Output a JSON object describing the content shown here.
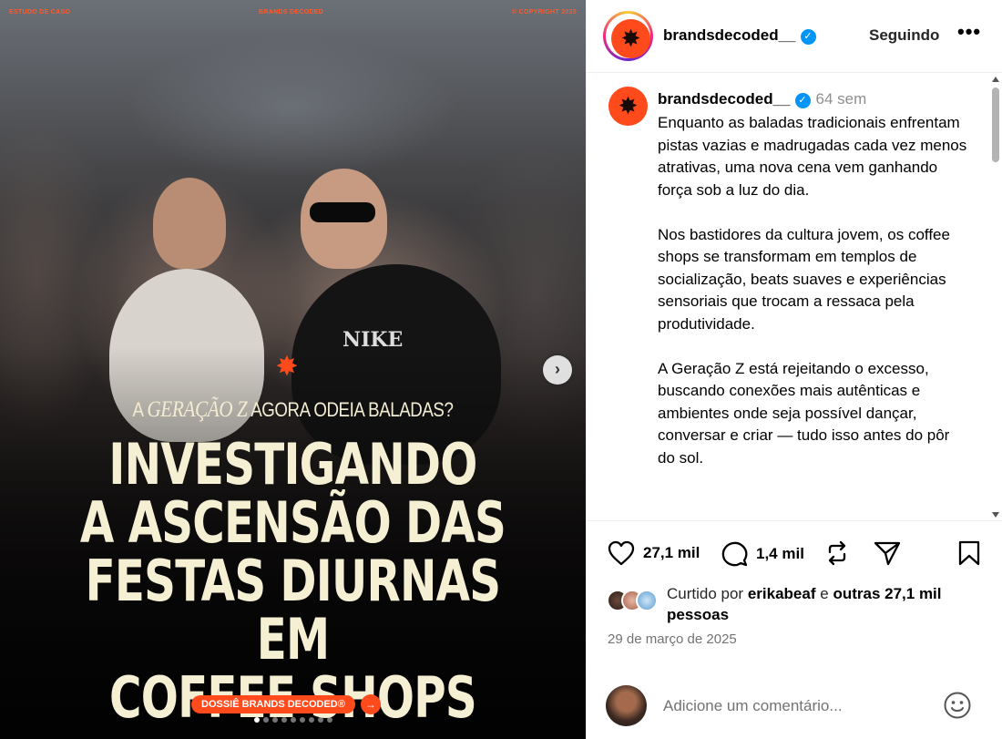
{
  "media": {
    "top_labels": [
      "ESTUDO DE CASO",
      "BRANDS DECODED",
      "© COPYRIGHT 2025"
    ],
    "kicker_pre": "A",
    "kicker_em": "GERAÇÃO Z",
    "kicker_post": "AGORA ODEIA BALADAS?",
    "headline_lines": [
      "INVESTIGANDO",
      "A ASCENSÃO DAS",
      "FESTAS DIURNAS EM",
      "COFFEE SHOPS"
    ],
    "cta_label": "DOSSIÊ BRANDS DECODED®",
    "cta_arrow": "→",
    "next_button": "›",
    "star_glyph": "✸",
    "shirt_text": "NIKE",
    "carousel_total": 9,
    "carousel_active": 1,
    "accent_color": "#ff4a1c"
  },
  "header": {
    "username": "brandsdecoded__",
    "follow_label": "Seguindo",
    "more_label": "•••",
    "verified_glyph": "✓",
    "avatar_glyph": "✸"
  },
  "caption": {
    "username": "brandsdecoded__",
    "time": "64 sem",
    "paragraphs": [
      "Enquanto as baladas tradicionais enfrentam pistas vazias e madrugadas cada vez menos atrativas, uma nova cena vem ganhando força sob a luz do dia.",
      "Nos bastidores da cultura jovem, os coffee shops se transformam em templos de socialização, beats suaves e experiências sensoriais que trocam a ressaca pela produtividade.",
      "A Geração Z está rejeitando o excesso, buscando conexões mais autênticas e ambientes onde seja possível dançar, conversar e criar — tudo isso antes do pôr do sol."
    ]
  },
  "actions": {
    "like_count": "27,1 mil",
    "comment_count": "1,4 mil",
    "icons": [
      "heart-icon",
      "comment-icon",
      "repost-icon",
      "share-icon",
      "bookmark-icon"
    ]
  },
  "likes": {
    "prefix": "Curtido por",
    "user": "erikabeaf",
    "connector": "e",
    "rest": "outras 27,1 mil pessoas"
  },
  "date": "29 de março de 2025",
  "comment": {
    "placeholder": "Adicione um comentário..."
  }
}
